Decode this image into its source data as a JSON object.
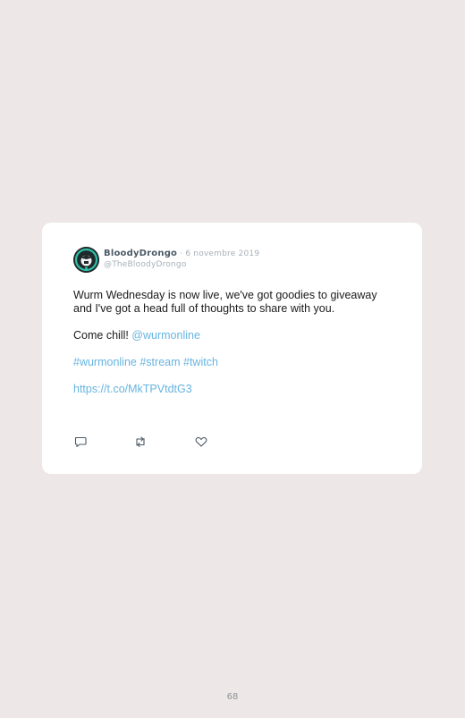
{
  "tweet": {
    "display_name": "BloodyDrongo",
    "separator": " · ",
    "date": "6 novembre 2019",
    "handle": "@TheBloodyDrongo",
    "text_line1": "Wurm Wednesday is now live, we've got goodies to giveaway and I've got a head full of thoughts to share with you.",
    "text_come_chill": "Come chill! ",
    "mention": "@wurmonline",
    "hashtag1": "#wurmonline",
    "hashtag2": "#stream",
    "hashtag3": "#twitch",
    "url": "https://t.co/MkTPVtdtG3"
  },
  "actions": {
    "reply_icon": "reply-icon",
    "retweet_icon": "retweet-icon",
    "like_icon": "heart-icon"
  },
  "page": {
    "number": "68"
  },
  "colors": {
    "background": "#ede7e7",
    "card": "#ffffff",
    "link": "#67b4e0",
    "muted": "#a7b0b8",
    "name": "#4b5a66"
  }
}
